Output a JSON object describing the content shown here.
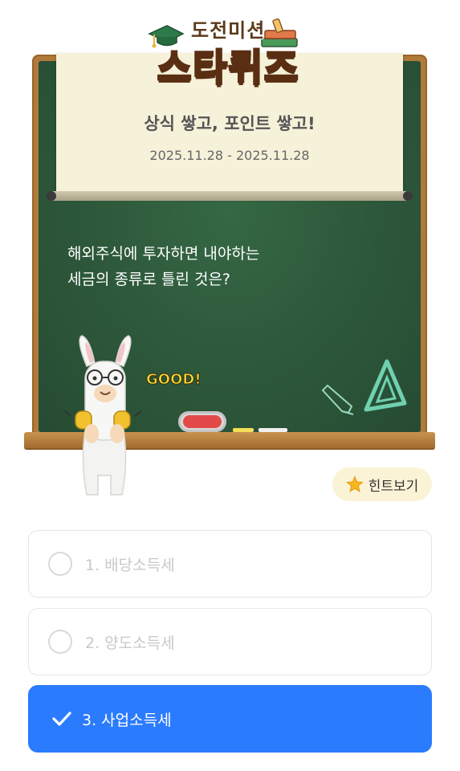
{
  "logo": {
    "top_text": "도전미션",
    "main_text": "스타퀴즈"
  },
  "banner": {
    "subtitle": "상식 쌓고, 포인트 쌓고!",
    "date_range": "2025.11.28 - 2025.11.28"
  },
  "question": {
    "text": "해외주식에 투자하면 내야하는\n세금의 종류로 틀린 것은?"
  },
  "mascot": {
    "sign_text": "GOOD!"
  },
  "hint": {
    "label": "힌트보기",
    "icon": "star-icon"
  },
  "options": [
    {
      "label": "1. 배당소득세",
      "selected": false
    },
    {
      "label": "2. 양도소득세",
      "selected": false
    },
    {
      "label": "3. 사업소득세",
      "selected": true
    }
  ],
  "colors": {
    "selected": "#2b7bff",
    "board": "#2e5a3b",
    "frame": "#b07a3a",
    "hint_bg": "#fbf3d6"
  }
}
